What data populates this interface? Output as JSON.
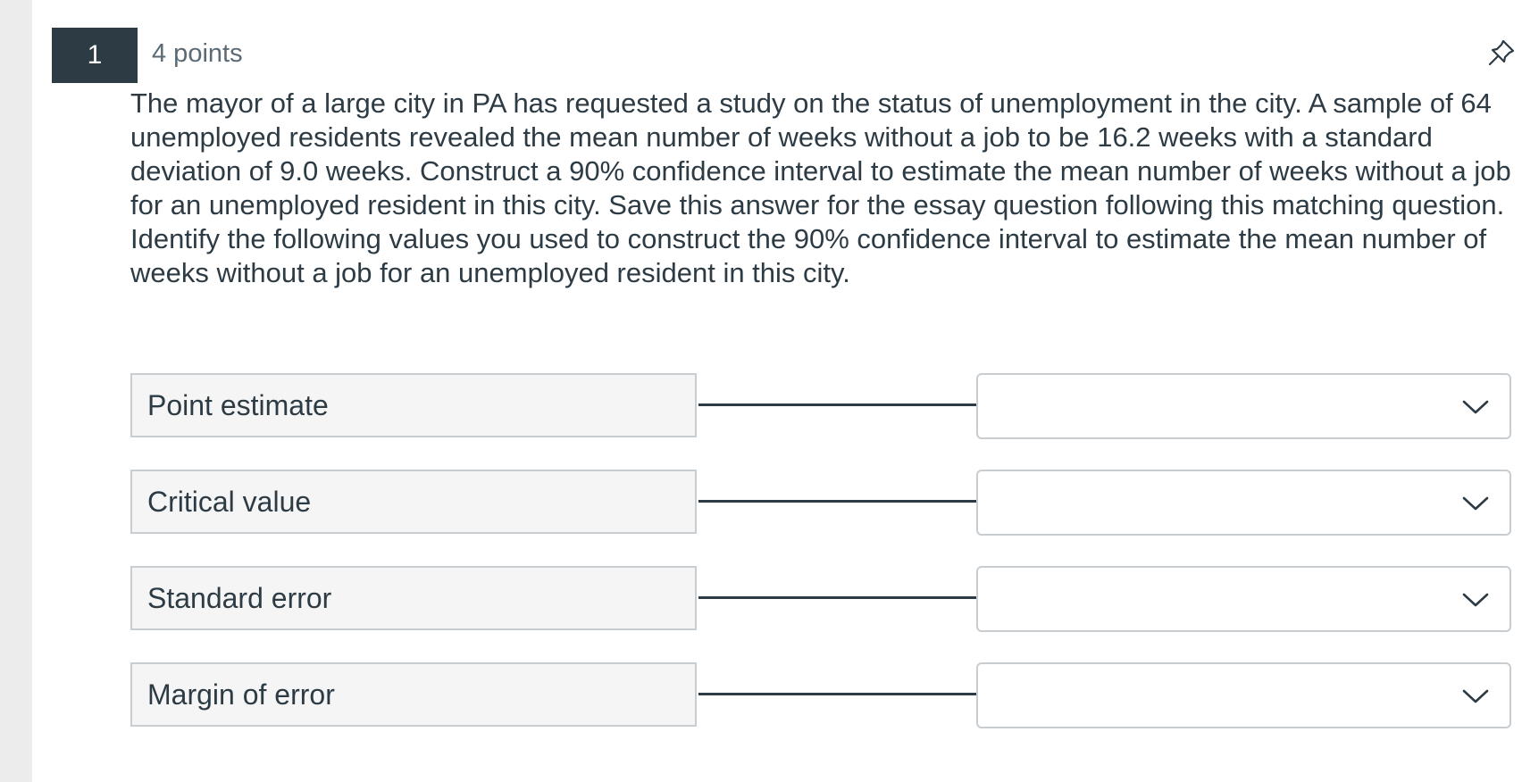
{
  "question": {
    "number": "1",
    "points": "4 points",
    "paragraphs": [
      "The mayor of a large city in PA has requested a study on the status of unemployment in the city.  A sample of 64 unemployed residents revealed the mean number of weeks without a job to be 16.2 weeks with a standard deviation of 9.0 weeks.  Construct a 90% confidence interval to estimate the mean number of weeks without a job for an unemployed resident in this city.  Save this answer for the essay question following this matching question.",
      "Identify the following values you used to construct the 90% confidence interval to estimate the mean number of weeks without a job for an unemployed resident in this city."
    ],
    "pin_icon": "pin-icon"
  },
  "matching": {
    "rows": [
      {
        "label": "Point estimate",
        "selected": ""
      },
      {
        "label": "Critical value",
        "selected": ""
      },
      {
        "label": "Standard error",
        "selected": ""
      },
      {
        "label": "Margin of error",
        "selected": ""
      }
    ],
    "dropdown_icon": "chevron-down-icon"
  },
  "colors": {
    "header_badge": "#2d3b45",
    "text": "#2d3b45",
    "border": "#c7cdd1",
    "label_bg": "#f5f5f5"
  }
}
